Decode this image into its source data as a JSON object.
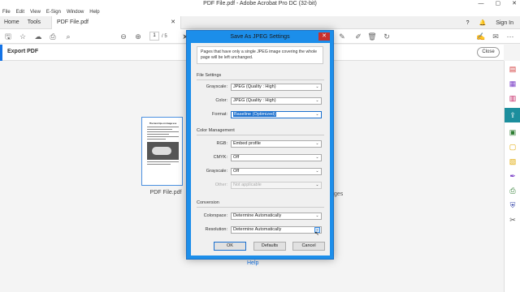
{
  "window": {
    "title": "PDF File.pdf - Adobe Acrobat Pro DC (32-bit)",
    "controls": [
      "—",
      "▢",
      "✕"
    ]
  },
  "menu": [
    "File",
    "Edit",
    "View",
    "E-Sign",
    "Window",
    "Help"
  ],
  "tabs": {
    "home": "Home",
    "tools": "Tools",
    "document": "PDF File.pdf",
    "document_close": "✕",
    "signin": "Sign In"
  },
  "toolbar": {
    "current_page": "1",
    "total_pages": "/ 5"
  },
  "export_panel": {
    "title": "Export PDF",
    "close_label": "Close"
  },
  "thumbnail": {
    "caption": "PDF File.pdf",
    "doc_title": "The best tips on image use"
  },
  "background": {
    "partial_text": "ges",
    "help_link": "Help"
  },
  "dialog": {
    "title": "Save As JPEG Settings",
    "close_label": "✕",
    "notice": "Pages that have only a single JPEG image covering the whole page will be left unchanged.",
    "file_settings": {
      "header": "File Settings",
      "grayscale_label": "Grayscale:",
      "grayscale_value": "JPEG (Quality : High)",
      "color_label": "Color:",
      "color_value": "JPEG (Quality : High)",
      "format_label": "Format:",
      "format_value": "Baseline (Optimized)"
    },
    "color_management": {
      "header": "Color Management",
      "rgb_label": "RGB:",
      "rgb_value": "Embed profile",
      "cmyk_label": "CMYK:",
      "cmyk_value": "Off",
      "grayscale_label": "Grayscale:",
      "grayscale_value": "Off",
      "other_label": "Other:",
      "other_value": "Not applicable"
    },
    "conversion": {
      "header": "Conversion",
      "colorspace_label": "Colorspace:",
      "colorspace_value": "Determine Automatically",
      "resolution_label": "Resolution:",
      "resolution_value": "Determine Automatically"
    },
    "buttons": {
      "ok": "OK",
      "defaults": "Defaults",
      "cancel": "Cancel"
    }
  },
  "colors": {
    "dialog_frame": "#1c8eea",
    "accent": "#1473e6",
    "export_rail_active": "#1c8e9d"
  }
}
